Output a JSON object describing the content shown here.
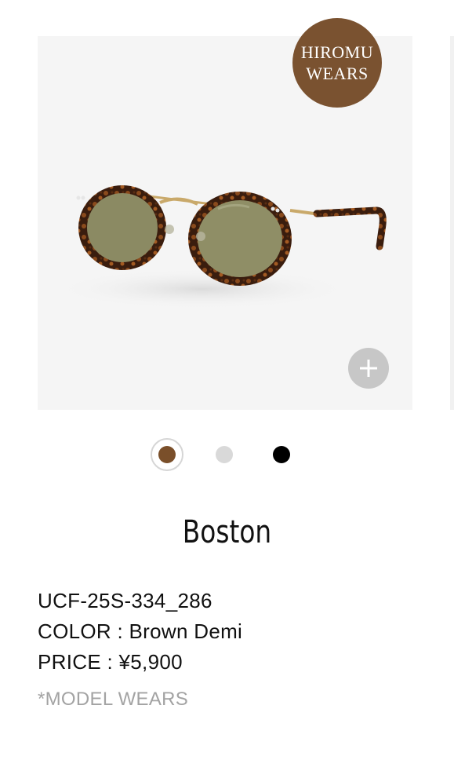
{
  "badge": {
    "line1": "HIROMU",
    "line2": "WEARS",
    "color": "#7a5230"
  },
  "product_image": {
    "subject": "round tortoiseshell sunglasses with olive lenses and gold temples",
    "zoom_icon": "plus-icon"
  },
  "color_options": [
    {
      "label": "Brown Demi",
      "color": "#7a4f2a",
      "selected": true
    },
    {
      "label": "Clear Grey",
      "color": "#d9d9d9",
      "selected": false
    },
    {
      "label": "Black",
      "color": "#000000",
      "selected": false
    }
  ],
  "product": {
    "name": "Boston",
    "code": "UCF-25S-334_286",
    "color_line": "COLOR : Brown Demi",
    "price_line": "PRICE : ¥5,900",
    "model_note": "*MODEL WEARS"
  }
}
